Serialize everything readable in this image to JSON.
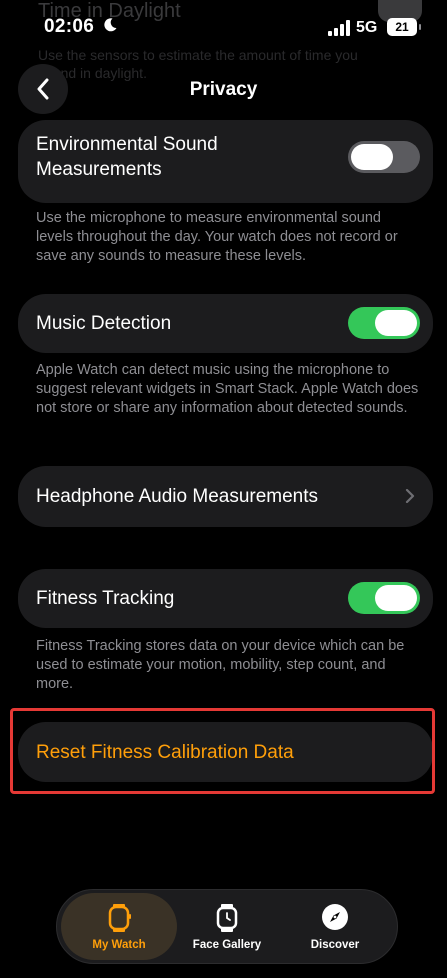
{
  "background_fragment": {
    "title": "Time in Daylight",
    "text_line1": "Use the sensors to estimate the amount of time you",
    "text_line2": "spend in daylight."
  },
  "status_bar": {
    "time": "02:06",
    "network": "5G",
    "battery": "21"
  },
  "nav": {
    "title": "Privacy"
  },
  "env_sound": {
    "label_line1": "Environmental Sound",
    "label_line2": "Measurements",
    "toggle_state": "off",
    "footnote": "Use the microphone to measure environmental sound levels throughout the day. Your watch does not record or save any sounds to measure these levels."
  },
  "music_detection": {
    "label": "Music Detection",
    "toggle_state": "on",
    "footnote": "Apple Watch can detect music using the microphone to suggest relevant widgets in Smart Stack. Apple Watch does not store or share any information about detected sounds."
  },
  "headphone_audio": {
    "label": "Headphone Audio Measurements"
  },
  "fitness_tracking": {
    "label": "Fitness Tracking",
    "toggle_state": "on",
    "footnote": "Fitness Tracking stores data on your device which can be used to estimate your motion, mobility, step count, and more."
  },
  "reset": {
    "label": "Reset Fitness Calibration Data"
  },
  "tabbar": {
    "tabs": [
      {
        "label": "My Watch",
        "icon": "watch-icon",
        "active": true
      },
      {
        "label": "Face Gallery",
        "icon": "face-gallery-icon",
        "active": false
      },
      {
        "label": "Discover",
        "icon": "compass-icon",
        "active": false
      }
    ]
  },
  "colors": {
    "accent": "#ff9f0a",
    "toggle_on": "#34c759",
    "card_bg": "#1c1c1e",
    "highlight_border": "#e53935"
  }
}
